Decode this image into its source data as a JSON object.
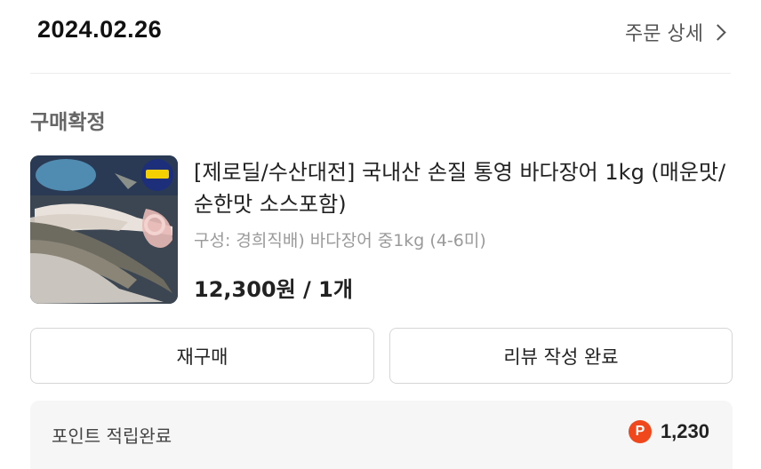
{
  "order": {
    "date": "2024.02.26",
    "detail_label": "주문 상세"
  },
  "status": "구매확정",
  "product": {
    "title": "[제로딜/수산대전] 국내산 손질 통영 바다장어 1kg (매운맛/순한맛 소스포함)",
    "option": "구성: 경희직배) 바다장어 중1kg (4-6미)",
    "price": "12,300원 / 1개",
    "thumbnail_icon": "eel-product-photo"
  },
  "buttons": {
    "rebuy": "재구매",
    "review": "리뷰 작성 완료"
  },
  "points": {
    "label": "포인트 적립완료",
    "badge": "P",
    "amount": "1,230"
  },
  "colors": {
    "point_badge": "#f0481c",
    "muted_text": "#9a9a9a"
  }
}
